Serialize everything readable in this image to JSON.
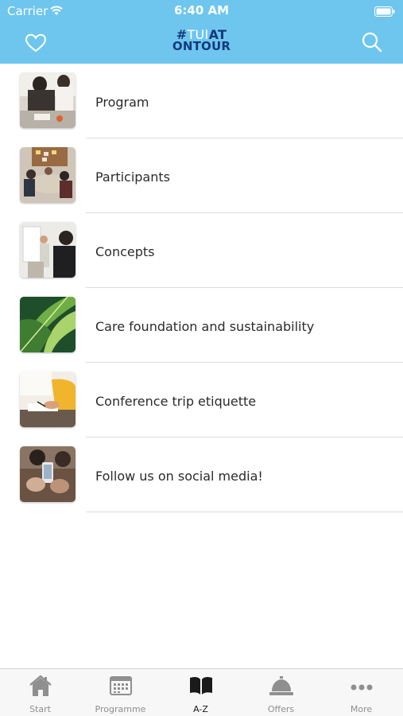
{
  "status_bar": {
    "carrier": "Carrier",
    "time": "6:40 AM"
  },
  "header": {
    "logo_line1_hash": "#",
    "logo_line1_tui": "TUI",
    "logo_line1_at": "AT",
    "logo_line2": "ONTOUR",
    "brand_color": "#6ec6ee",
    "logo_text_color": "#153a7c",
    "icons": [
      "heart-icon",
      "search-icon"
    ]
  },
  "list": {
    "items": [
      {
        "label": "Program",
        "thumb": "meeting-photo"
      },
      {
        "label": "Participants",
        "thumb": "participants-photo"
      },
      {
        "label": "Concepts",
        "thumb": "concepts-photo"
      },
      {
        "label": "Care foundation and sustainability",
        "thumb": "leaves-photo"
      },
      {
        "label": "Conference trip etiquette",
        "thumb": "writing-photo"
      },
      {
        "label": "Follow us on social media!",
        "thumb": "phone-photo"
      }
    ]
  },
  "tabbar": {
    "tabs": [
      {
        "label": "Start",
        "icon": "home-icon"
      },
      {
        "label": "Programme",
        "icon": "calendar-icon"
      },
      {
        "label": "A-Z",
        "icon": "book-icon",
        "active": true
      },
      {
        "label": "Offers",
        "icon": "service-bell-icon"
      },
      {
        "label": "More",
        "icon": "more-dots-icon"
      }
    ]
  }
}
